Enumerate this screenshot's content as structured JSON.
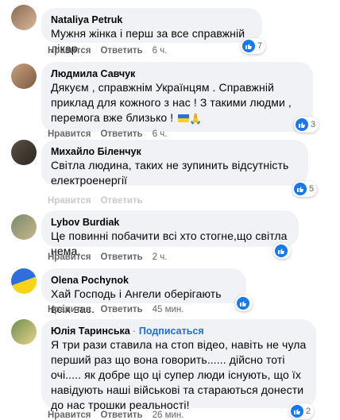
{
  "icons": {
    "like": "like-icon",
    "flag": "ukraine-flag-emoji",
    "hands": "folded-hands-emoji"
  },
  "colors": {
    "bubble": "#f0f2f5",
    "like_blue": "#1877f2",
    "follow": "#216fdb",
    "meta": "#65676b"
  },
  "labels": {
    "like": "Нравится",
    "reply": "Ответить"
  },
  "comments": [
    {
      "author": "Nataliya Petruk",
      "text": "Мужня жінка і перш за все справжній лікар",
      "time": "6 ч.",
      "reactions": "7"
    },
    {
      "author": "Людмила Савчук",
      "text": "Дякуєм , справжнім Українцям . Справжній приклад для кожного з нас ! З такими людми , перемога вже близько !",
      "time": "6 ч.",
      "reactions": "3"
    },
    {
      "author": "Михайло Біленчук",
      "text": "Світла людина, таких не зупинить відсутність електроенергії",
      "time": "",
      "reactions": "5"
    },
    {
      "author": "Lybov Burdiak",
      "text": "Це повинні побачити всі хто стогне,що світла нема.",
      "time": "2 ч.",
      "reactions": ""
    },
    {
      "author": "Olena Pochynok",
      "text": "Хай Господь і Ангели оберігають всіх вас.",
      "time": "45 мин.",
      "reactions": ""
    },
    {
      "author": "Юлія Таринська",
      "follow": "Подписаться",
      "text": "Я три рази ставила на стоп відео, навіть не чула перший раз що вона говорить...... дійсно тоті очі..... як добре що ці супер люди існують, що їх навідують наші військові та стараються донести до нас трошки реальності!",
      "time": "26 мин.",
      "reactions": "2"
    }
  ]
}
